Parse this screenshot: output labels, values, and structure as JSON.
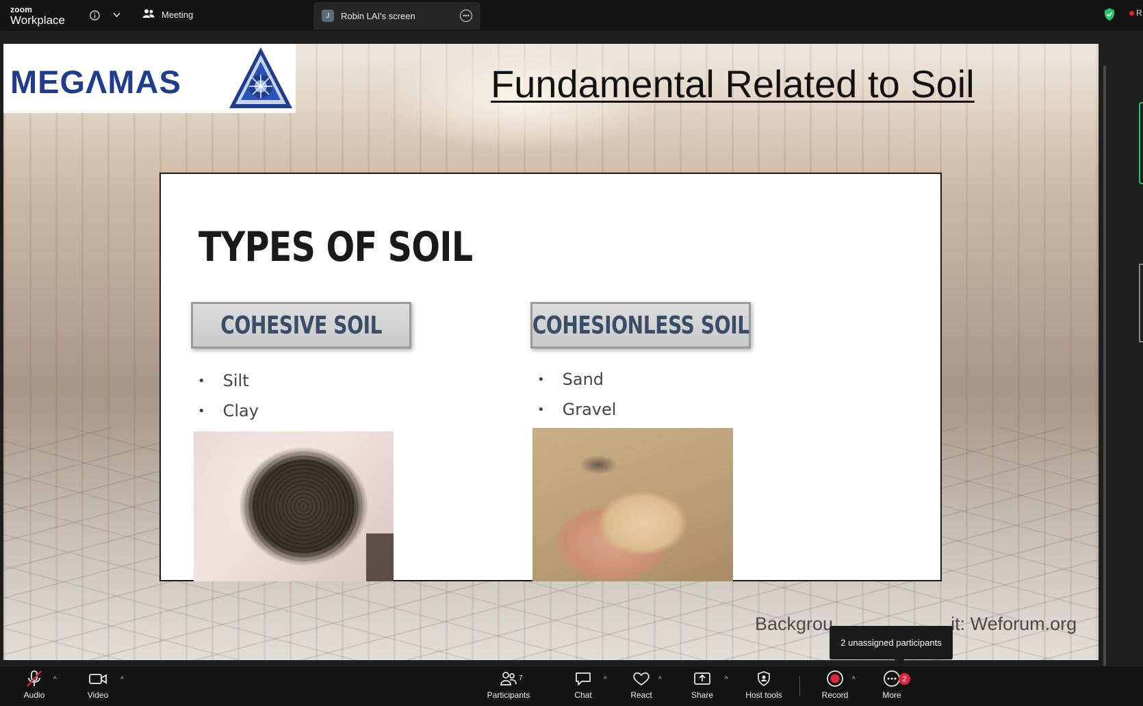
{
  "topbar": {
    "brand_small": "zoom",
    "brand_big": "Workplace",
    "meeting_label": "Meeting",
    "screen_tab_avatar": "J",
    "screen_tab_label": "Robin LAI's screen",
    "record_indicator": "R",
    "icons": [
      "info-icon",
      "chevron-down-icon",
      "people-icon",
      "more-options-icon",
      "shield-check-icon"
    ],
    "shield_color": "#27c46b",
    "record_color": "#e02828"
  },
  "slide": {
    "logo_text": "MEGΛMAS",
    "title": "Fundamental Related to Soil",
    "inner_title": "TYPES OF SOIL",
    "cohesive": {
      "heading": "COHESIVE SOIL",
      "items": [
        "Silt",
        "Clay"
      ]
    },
    "cohesionless": {
      "heading": "COHESIONLESS SOIL",
      "items": [
        "Sand",
        "Gravel"
      ]
    },
    "credit_visible": "Backgrou",
    "credit_tail": "it: Weforum.org"
  },
  "tooltip": "2 unassigned participants",
  "toolbar": {
    "audio": "Audio",
    "video": "Video",
    "participants": "Participants",
    "participants_count": "7",
    "chat": "Chat",
    "react": "React",
    "share": "Share",
    "host_tools": "Host tools",
    "record": "Record",
    "more": "More",
    "more_badge": "2",
    "badge_color": "#e0263f"
  }
}
